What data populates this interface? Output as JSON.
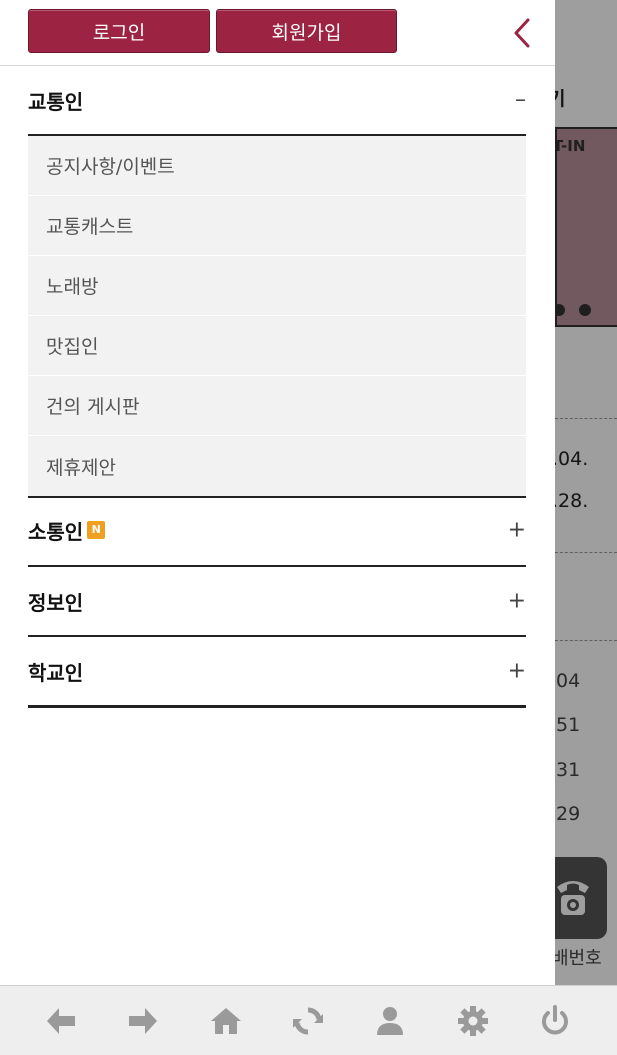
{
  "header": {
    "login_label": "로그인",
    "signup_label": "회원가입"
  },
  "menu": {
    "sections": [
      {
        "title": "교통인",
        "toggle": "–",
        "items": [
          "공지사항/이벤트",
          "교통캐스트",
          "노래방",
          "맛집인",
          "건의 게시판",
          "제휴제안"
        ]
      },
      {
        "title": "소통인",
        "badge": "N",
        "toggle": "+"
      },
      {
        "title": "정보인",
        "toggle": "+"
      },
      {
        "title": "학교인",
        "toggle": "+"
      }
    ]
  },
  "background": {
    "heading_fragment": "기",
    "banner_logo_fragment": "T-IN",
    "dates": [
      ".04.",
      ".28."
    ],
    "numbers": [
      "04",
      "51",
      "31",
      "29"
    ],
    "phone_label_fragment": "배번호"
  },
  "colors": {
    "accent": "#9c2442",
    "badge": "#f0a020",
    "toolbar_icon": "#9a9a9a"
  },
  "toolbar": {
    "icons": [
      "back-arrow-icon",
      "forward-arrow-icon",
      "home-icon",
      "refresh-icon",
      "user-icon",
      "gear-icon",
      "power-icon"
    ]
  }
}
